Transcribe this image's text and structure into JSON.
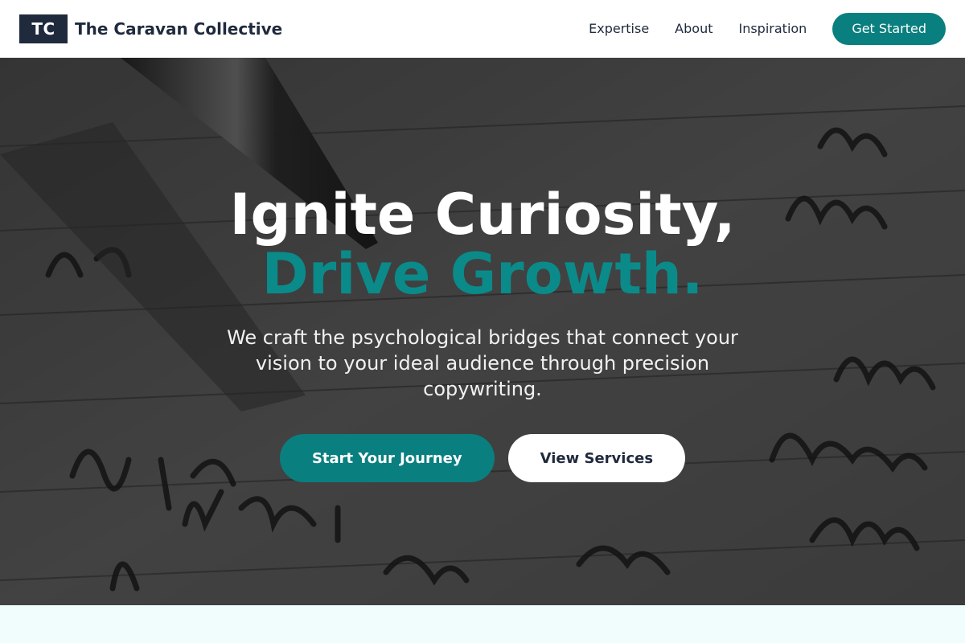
{
  "header": {
    "logo_text": "TC",
    "brand_name": "The Caravan Collective",
    "nav": [
      {
        "label": "Expertise"
      },
      {
        "label": "About"
      },
      {
        "label": "Inspiration"
      }
    ],
    "cta_label": "Get Started"
  },
  "hero": {
    "headline_line1": "Ignite Curiosity,",
    "headline_line2": "Drive Growth.",
    "subtitle": "We craft the psychological bridges that connect your vision to your ideal audience through precision copywriting.",
    "primary_button": "Start Your Journey",
    "secondary_button": "View Services",
    "background_image": "handwritten-notebook-with-pen-photo"
  },
  "colors": {
    "accent": "#0a7f7f",
    "navy": "#1f2a3d",
    "section_bg": "#f0fdfc"
  }
}
